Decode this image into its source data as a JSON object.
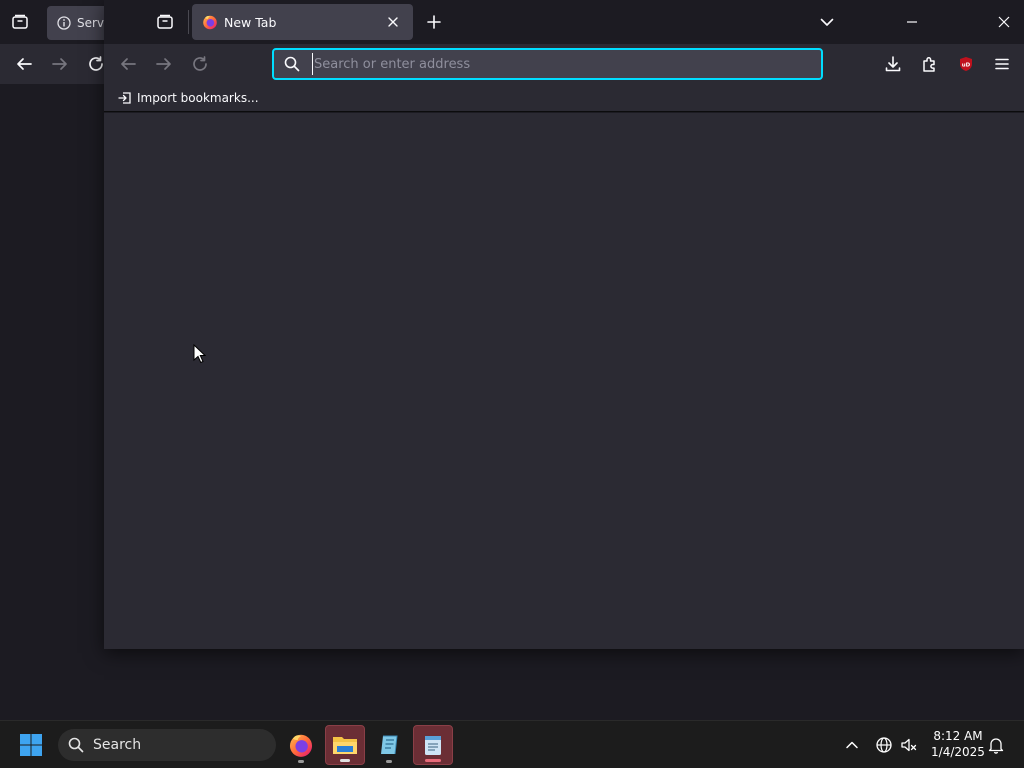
{
  "background_window": {
    "tab_title": "Serve"
  },
  "browser": {
    "tab": {
      "title": "New Tab"
    },
    "urlbar": {
      "placeholder": "Search or enter address",
      "value": ""
    },
    "bookmarks_toolbar": {
      "import_label": "Import bookmarks..."
    }
  },
  "taskbar": {
    "search_label": "Search",
    "apps": [
      "firefox-icon",
      "file-explorer-icon",
      "editor-icon",
      "notepad-icon"
    ],
    "clock": {
      "time": "8:12 AM",
      "date": "1/4/2025"
    }
  },
  "colors": {
    "accent_focus": "#00ddff",
    "toolbar": "#2b2a33",
    "tabbar": "#1c1b22",
    "tab_selected": "#42414d",
    "ublock": "#c0111d"
  }
}
